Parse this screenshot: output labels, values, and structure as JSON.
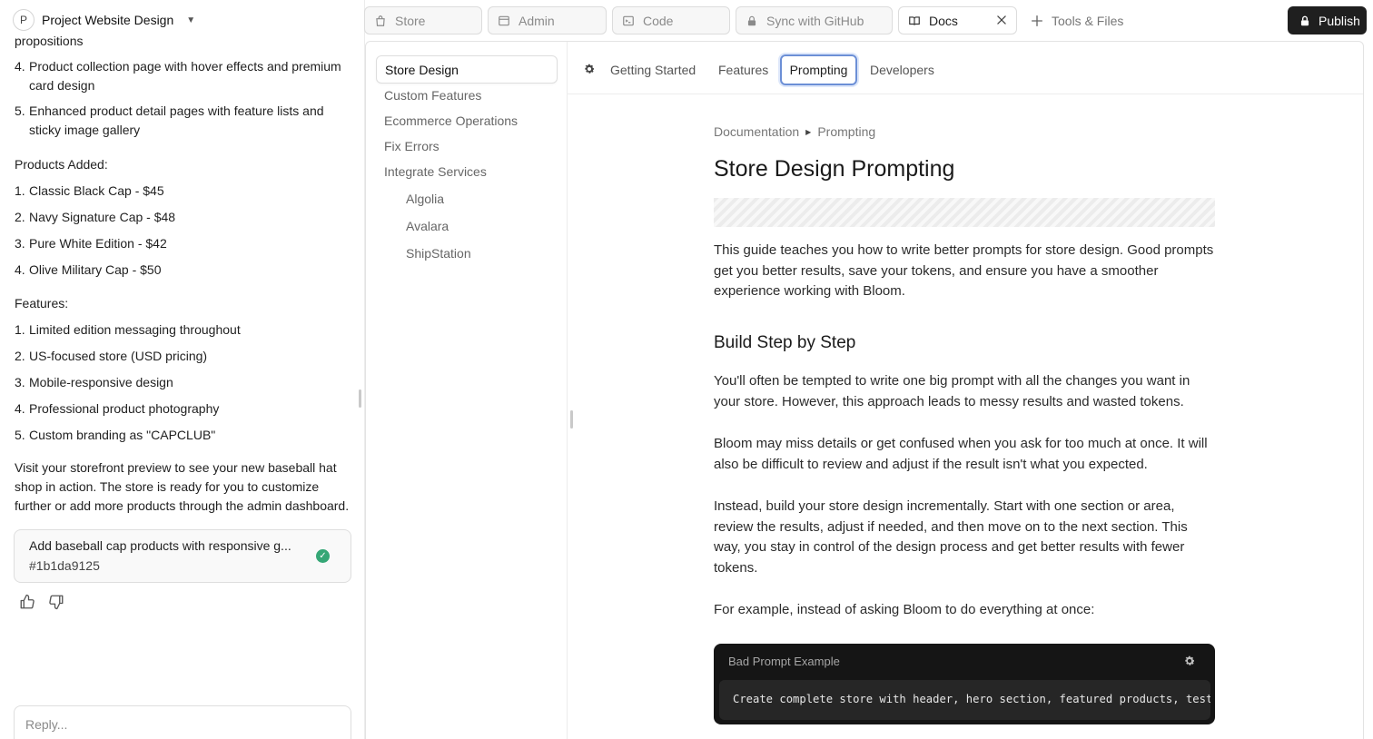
{
  "project": {
    "avatar_letter": "P",
    "name": "Project Website Design"
  },
  "chat": {
    "lines": [
      {
        "type": "text",
        "text": "propositions"
      },
      {
        "type": "item",
        "num": "4.",
        "text": "Product collection page with hover effects and premium card design"
      },
      {
        "type": "item",
        "num": "5.",
        "text": "Enhanced product detail pages with feature lists and sticky image gallery"
      },
      {
        "type": "heading",
        "text": "Products Added:"
      },
      {
        "type": "item",
        "num": "1.",
        "text": "Classic Black Cap - $45"
      },
      {
        "type": "item",
        "num": "2.",
        "text": "Navy Signature Cap - $48"
      },
      {
        "type": "item",
        "num": "3.",
        "text": "Pure White Edition - $42"
      },
      {
        "type": "item",
        "num": "4.",
        "text": "Olive Military Cap - $50"
      },
      {
        "type": "heading",
        "text": "Features:"
      },
      {
        "type": "item",
        "num": "1.",
        "text": "Limited edition messaging throughout"
      },
      {
        "type": "item",
        "num": "2.",
        "text": "US-focused store (USD pricing)"
      },
      {
        "type": "item",
        "num": "3.",
        "text": "Mobile-responsive design"
      },
      {
        "type": "item",
        "num": "4.",
        "text": "Professional product photography"
      },
      {
        "type": "item",
        "num": "5.",
        "text": "Custom branding as \"CAPCLUB\""
      },
      {
        "type": "text",
        "text": "Visit your storefront preview to see your new baseball hat shop in action. The store is ready for you to customize further or add more products through the admin dashboard."
      }
    ],
    "commit": {
      "title": "Add baseball cap products with responsive g...",
      "hash": "#1b1da9125"
    },
    "reply_placeholder": "Reply..."
  },
  "top_tabs": {
    "store": "Store",
    "admin": "Admin",
    "code": "Code",
    "sync": "Sync with GitHub",
    "docs": "Docs",
    "tools": "Tools & Files",
    "publish": "Publish"
  },
  "docs_nav": {
    "active": "Store Design",
    "items": [
      "Custom Features",
      "Ecommerce Operations",
      "Fix Errors",
      "Integrate Services"
    ],
    "sub_items": [
      "Algolia",
      "Avalara",
      "ShipStation"
    ]
  },
  "docs_tabs": [
    "Getting Started",
    "Features",
    "Prompting",
    "Developers"
  ],
  "article": {
    "breadcrumb": [
      "Documentation",
      "Prompting"
    ],
    "title": "Store Design Prompting",
    "intro": "This guide teaches you how to write better prompts for store design. Good prompts get you better results, save your tokens, and ensure you have a smoother experience working with Bloom.",
    "section_title": "Build Step by Step",
    "paragraphs": [
      "You'll often be tempted to write one big prompt with all the changes you want in your store. However, this approach leads to messy results and wasted tokens.",
      "Bloom may miss details or get confused when you ask for too much at once. It will also be difficult to review and adjust if the result isn't what you expected.",
      "Instead, build your store design incrementally. Start with one section or area, review the results, adjust if needed, and then move on to the next section. This way, you stay in control of the design process and get better results with fewer tokens.",
      "For example, instead of asking Bloom to do everything at once:"
    ],
    "code_title": "Bad Prompt Example",
    "code": "Create complete store with header, hero section, featured products, testimonials, newsletter signup and footer"
  },
  "colors": {
    "accent": "#6c8fd6",
    "success": "#35a776",
    "dark": "#1f1f1f"
  }
}
